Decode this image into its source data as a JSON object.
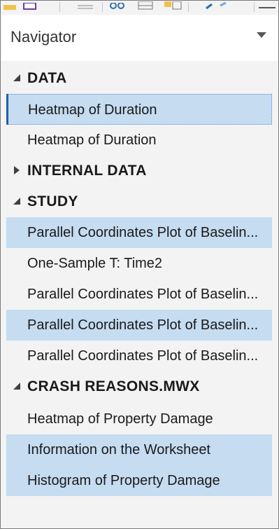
{
  "panel": {
    "title": "Navigator",
    "menu_icon": "chevron-down-icon"
  },
  "toolbar": {
    "icons": [
      "folder-icon",
      "worksheet-icon",
      "table-icon",
      "link-icon",
      "layout-icon",
      "note-icon",
      "arrow-icon",
      "window-icon"
    ]
  },
  "tree": {
    "groups": [
      {
        "label": "DATA",
        "expanded": true,
        "items": [
          {
            "label": "Heatmap of Duration",
            "state": "current"
          },
          {
            "label": "Heatmap of Duration",
            "state": "normal"
          }
        ]
      },
      {
        "label": "INTERNAL DATA",
        "expanded": false,
        "items": []
      },
      {
        "label": "STUDY",
        "expanded": true,
        "items": [
          {
            "label": "Parallel Coordinates Plot of Baselin...",
            "state": "selected"
          },
          {
            "label": "One-Sample T: Time2",
            "state": "normal"
          },
          {
            "label": "Parallel Coordinates Plot of Baselin...",
            "state": "normal"
          },
          {
            "label": "Parallel Coordinates Plot of Baselin...",
            "state": "selected"
          },
          {
            "label": "Parallel Coordinates Plot of Baselin...",
            "state": "normal"
          }
        ]
      },
      {
        "label": "CRASH REASONS.MWX",
        "expanded": true,
        "items": [
          {
            "label": "Heatmap of Property Damage",
            "state": "normal"
          },
          {
            "label": "Information on the Worksheet",
            "state": "selected"
          },
          {
            "label": "Histogram of Property Damage",
            "state": "selected"
          }
        ]
      }
    ]
  },
  "colors": {
    "selected_bg": "#c5dcf1",
    "current_marker": "#1f5fa8",
    "panel_bg": "#f3f3f3",
    "header_bg": "#ffffff"
  }
}
